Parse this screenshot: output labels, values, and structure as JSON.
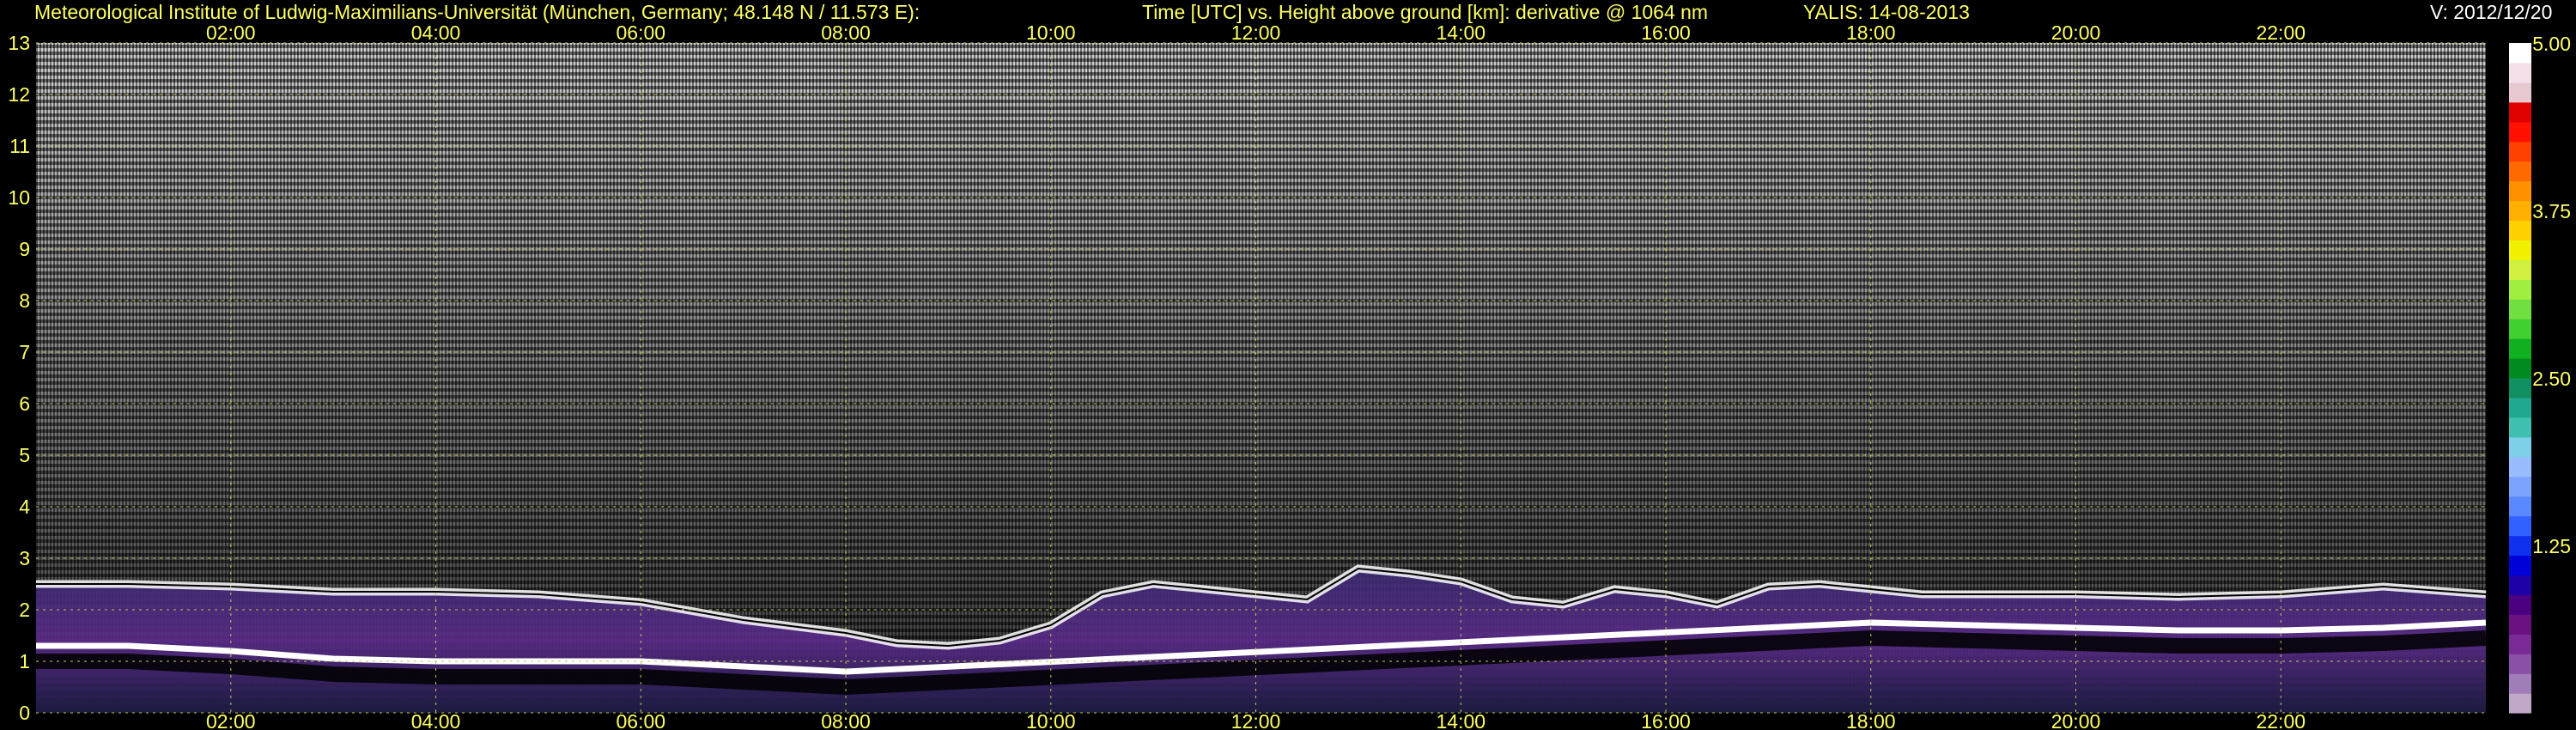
{
  "header": {
    "institute": "Meteorological Institute of Ludwig-Maximilians-Universität (München, Germany; 48.148 N / 11.573 E):",
    "title": "Time [UTC] vs. Height above ground [km]: derivative @ 1064 nm",
    "instrument": "YALIS: 14-08-2013",
    "version": "V: 2012/12/20"
  },
  "colors": {
    "text": "#ffff66",
    "grid": "#c8c850",
    "noise": "#9a9a9a",
    "layer": "#ffffff"
  },
  "chart_data": {
    "type": "heatmap",
    "xlabel": "Time [UTC]",
    "ylabel": "Height above ground [km]",
    "x_ticks": [
      "02:00",
      "04:00",
      "06:00",
      "08:00",
      "10:00",
      "12:00",
      "14:00",
      "16:00",
      "18:00",
      "20:00",
      "22:00"
    ],
    "x_tick_hours": [
      2,
      4,
      6,
      8,
      10,
      12,
      14,
      16,
      18,
      20,
      22
    ],
    "xlim_hours": [
      0.1,
      24
    ],
    "y_ticks": [
      "0",
      "1",
      "2",
      "3",
      "4",
      "5",
      "6",
      "7",
      "8",
      "9",
      "10",
      "11",
      "12",
      "13"
    ],
    "ylim_km": [
      0,
      13
    ],
    "grid": true,
    "colorbar": {
      "ticks": [
        "1.25",
        "2.50",
        "3.75",
        "5.00"
      ],
      "tick_values": [
        1.25,
        2.5,
        3.75,
        5.0
      ],
      "range": [
        0,
        5.0
      ],
      "colors": [
        "#bfa8c8",
        "#a07cb8",
        "#8a4fa6",
        "#7a2a96",
        "#6a1080",
        "#4a0080",
        "#2000a8",
        "#0000d8",
        "#1030f0",
        "#3060ff",
        "#5a88ff",
        "#7aa4ff",
        "#99bbff",
        "#7ed0e8",
        "#40c0b0",
        "#20a890",
        "#109060",
        "#008a20",
        "#10b020",
        "#40d030",
        "#70e040",
        "#a0ee40",
        "#d0f040",
        "#f0f000",
        "#ffd000",
        "#ffb000",
        "#ff9000",
        "#ff6a00",
        "#ff4000",
        "#ff1000",
        "#e00000",
        "#e8c8d0",
        "#f4e0e8",
        "#ffffff"
      ]
    },
    "boundary_layer_top_km": {
      "hours": [
        0.1,
        1,
        2,
        3,
        4,
        5,
        6,
        7,
        8,
        8.5,
        9,
        9.5,
        10,
        10.5,
        11,
        11.5,
        12,
        12.5,
        13,
        13.5,
        14,
        14.5,
        15,
        15.5,
        16,
        16.5,
        17,
        17.5,
        18,
        18.5,
        19,
        20,
        21,
        22,
        23,
        24
      ],
      "height": [
        2.5,
        2.5,
        2.45,
        2.35,
        2.35,
        2.3,
        2.15,
        1.8,
        1.55,
        1.35,
        1.3,
        1.4,
        1.7,
        2.3,
        2.5,
        2.4,
        2.3,
        2.2,
        2.8,
        2.7,
        2.55,
        2.2,
        2.1,
        2.4,
        2.3,
        2.1,
        2.45,
        2.5,
        2.4,
        2.3,
        2.3,
        2.3,
        2.25,
        2.3,
        2.45,
        2.3
      ]
    },
    "residual_layer_km": {
      "hours": [
        0.1,
        1,
        2,
        3,
        4,
        5,
        6,
        7,
        7.5,
        8,
        18,
        19,
        20,
        21,
        22,
        23,
        24
      ],
      "height": [
        1.3,
        1.3,
        1.2,
        1.05,
        1.0,
        1.0,
        1.0,
        0.9,
        0.85,
        0.8,
        1.75,
        1.7,
        1.65,
        1.6,
        1.6,
        1.65,
        1.75
      ]
    }
  }
}
